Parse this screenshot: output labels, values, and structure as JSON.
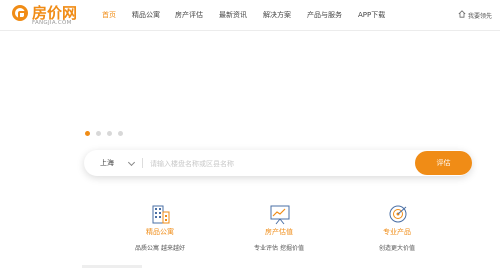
{
  "logo": {
    "name_cn": "房价网",
    "name_en": "FANGJIA.COM",
    "brand_color": "#f08c16"
  },
  "nav": {
    "items": [
      {
        "label": "首页",
        "active": true
      },
      {
        "label": "精品公寓"
      },
      {
        "label": "房产评估"
      },
      {
        "label": "最新资讯"
      },
      {
        "label": "解决方案"
      },
      {
        "label": "产品与服务"
      },
      {
        "label": "APP下载"
      }
    ],
    "account": {
      "icon": "home-icon",
      "label": "我要领先"
    }
  },
  "carousel": {
    "slide_count": 4,
    "active_index": 0
  },
  "search": {
    "city": "上海",
    "placeholder": "请输入楼盘名称或区县名称",
    "button_label": "评估"
  },
  "features": [
    {
      "icon": "building-icon",
      "title": "精品公寓",
      "desc": "品质公寓 越来越好"
    },
    {
      "icon": "chart-board-icon",
      "title": "房产估值",
      "desc": "专业评估 挖掘价值"
    },
    {
      "icon": "target-icon",
      "title": "专业产品",
      "desc": "创造更大价值"
    }
  ]
}
